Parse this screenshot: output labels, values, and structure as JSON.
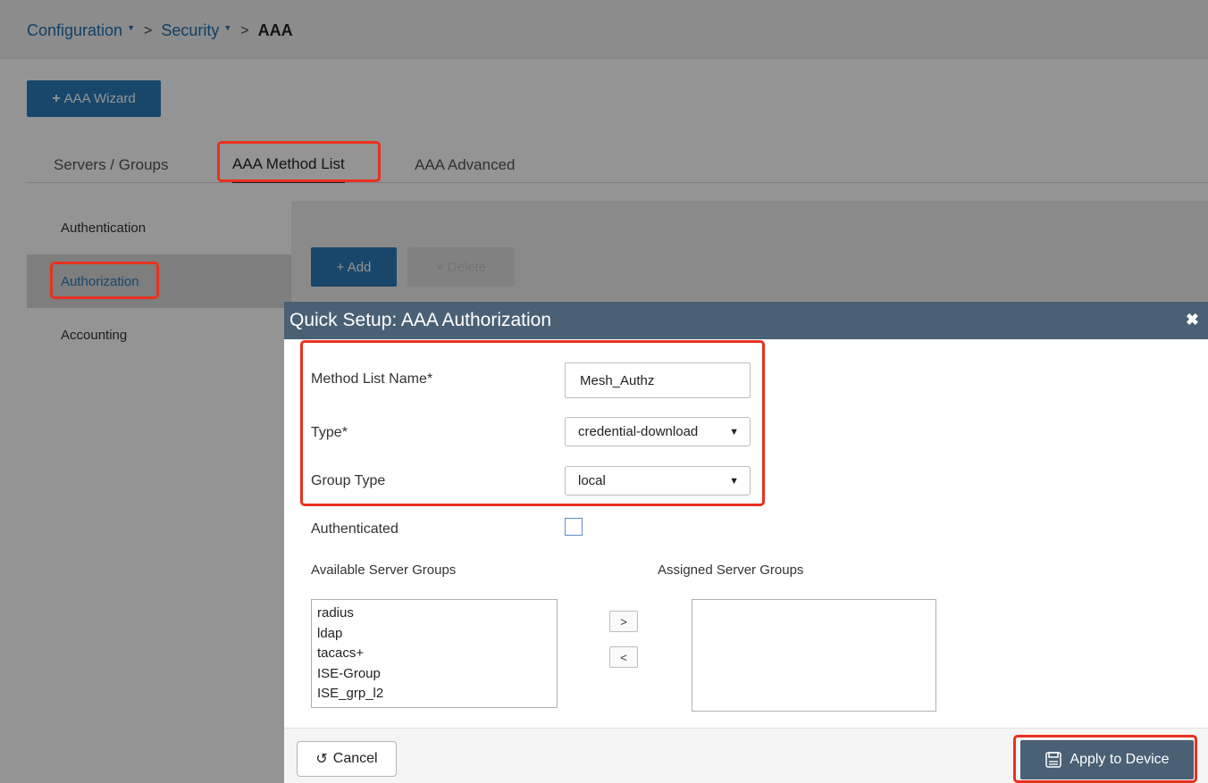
{
  "breadcrumb": {
    "items": [
      "Configuration",
      "Security"
    ],
    "current": "AAA",
    "separator": ">"
  },
  "wizard_button": {
    "icon": "plus-icon",
    "label": "AAA Wizard"
  },
  "tabs": [
    {
      "label": "Servers / Groups",
      "active": false
    },
    {
      "label": "AAA Method List",
      "active": true
    },
    {
      "label": "AAA Advanced",
      "active": false
    }
  ],
  "left_nav": {
    "items": [
      {
        "label": "Authentication",
        "selected": false
      },
      {
        "label": "Authorization",
        "selected": true
      },
      {
        "label": "Accounting",
        "selected": false
      }
    ]
  },
  "toolbar": {
    "add_label": "Add",
    "delete_label": "Delete"
  },
  "modal": {
    "title": "Quick Setup: AAA Authorization",
    "close_icon": "close-icon",
    "fields": {
      "method_list_name": {
        "label": "Method List Name*",
        "value": "Mesh_Authz"
      },
      "type": {
        "label": "Type*",
        "value": "credential-download"
      },
      "group_type": {
        "label": "Group Type",
        "value": "local"
      },
      "authenticated": {
        "label": "Authenticated",
        "checked": false
      }
    },
    "available_groups": {
      "label": "Available Server Groups",
      "items": [
        "radius",
        "ldap",
        "tacacs+",
        "ISE-Group",
        "ISE_grp_l2"
      ]
    },
    "assigned_groups": {
      "label": "Assigned Server Groups",
      "items": []
    },
    "move_right": ">",
    "move_left": "<",
    "cancel_label": "Cancel",
    "apply_label": "Apply to Device"
  },
  "colors": {
    "primary": "#2a7ab8",
    "modal_header": "#4a6075",
    "highlight": "#e8321f"
  }
}
